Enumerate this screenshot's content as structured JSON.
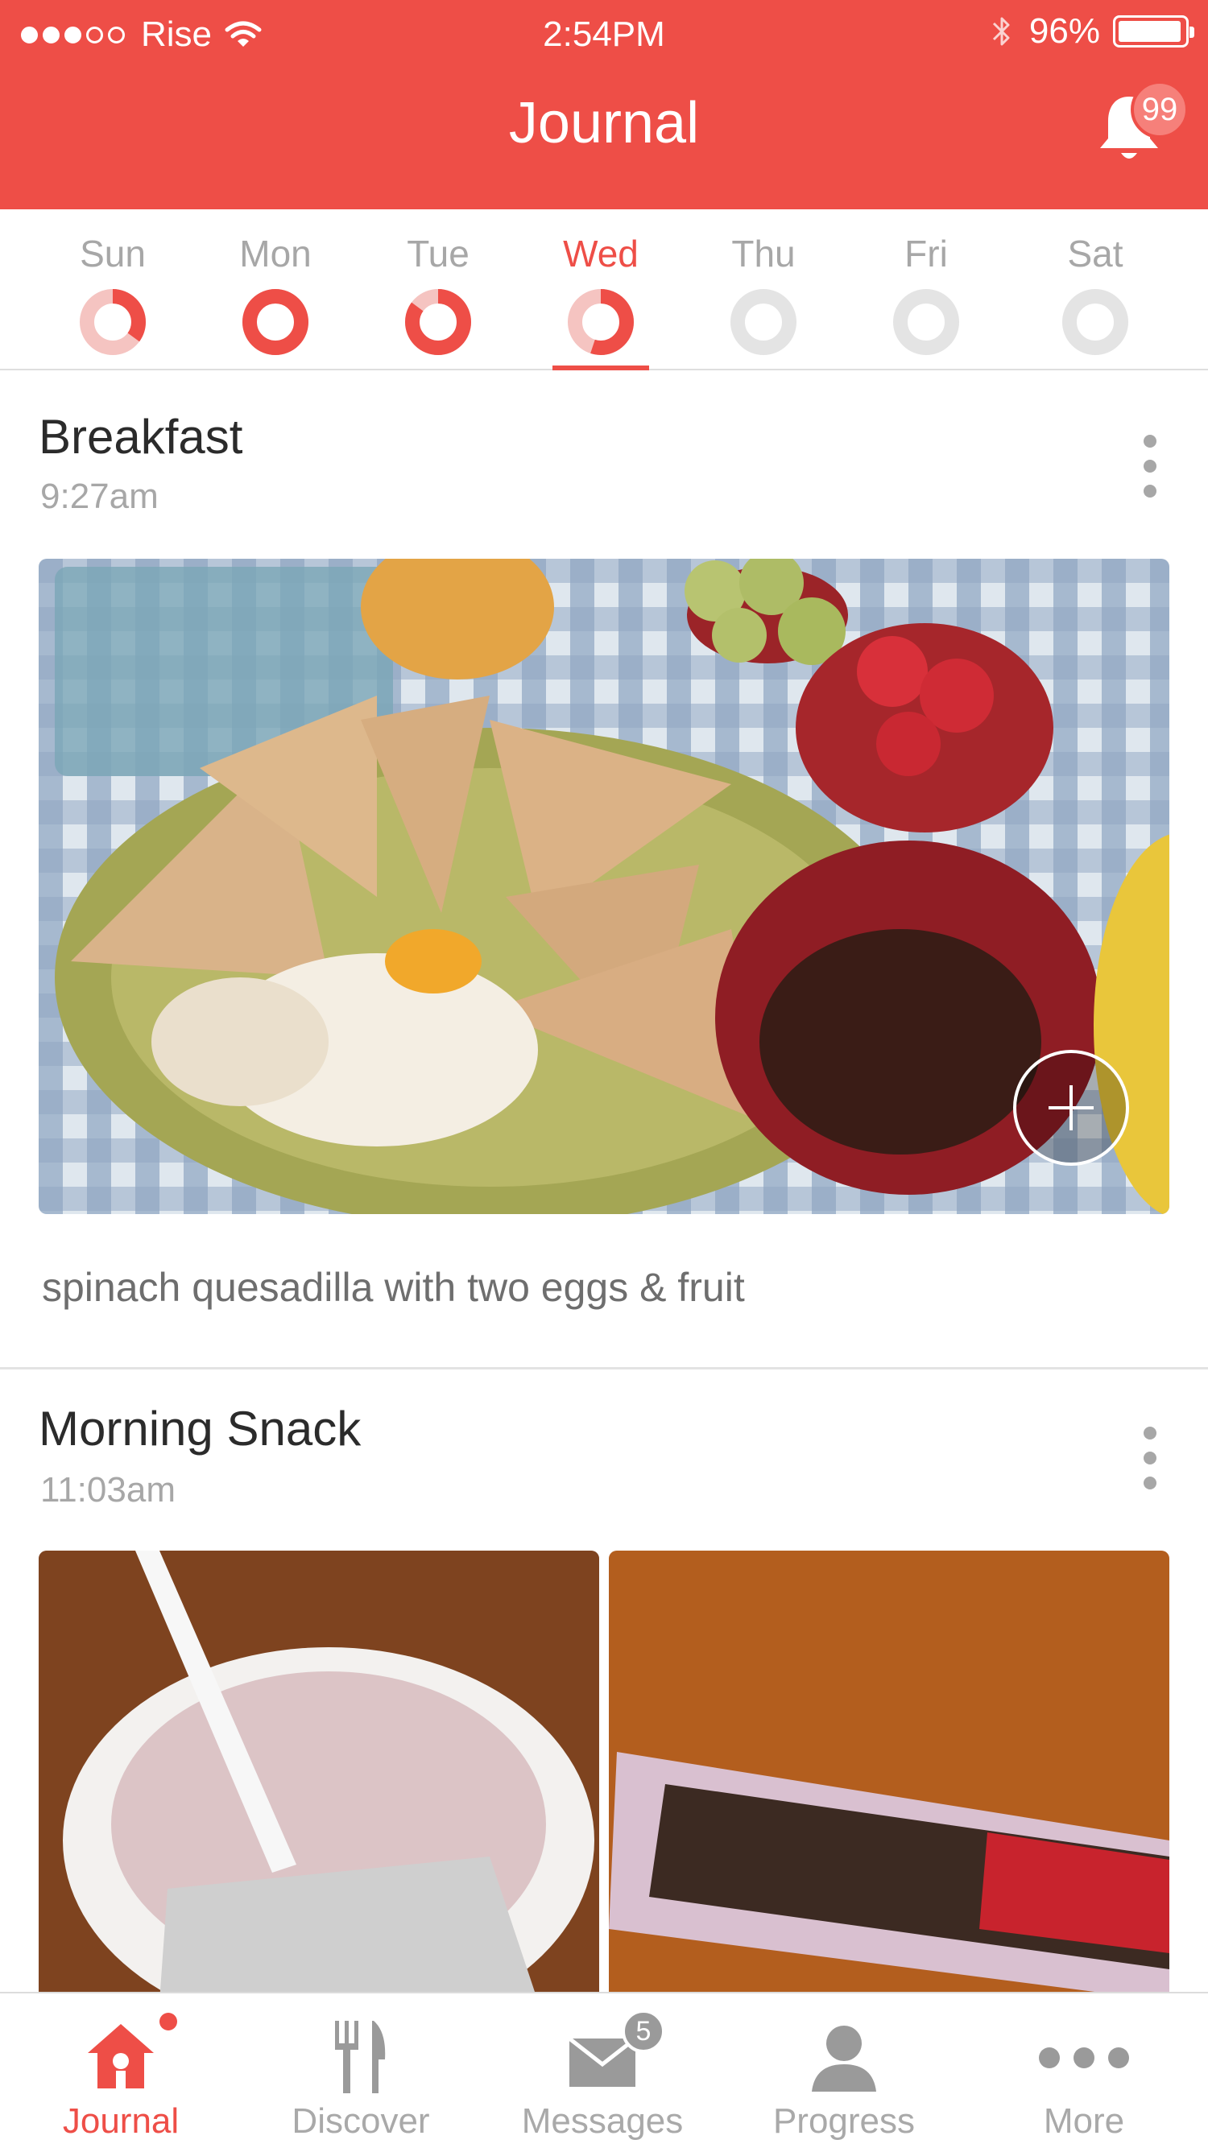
{
  "status_bar": {
    "carrier": "Rise",
    "time": "2:54PM",
    "battery": "96%",
    "battery_level": 0.96
  },
  "header": {
    "title": "Journal",
    "notification_count": "99"
  },
  "days": [
    {
      "label": "Sun",
      "progress": 0.35,
      "active": false
    },
    {
      "label": "Mon",
      "progress": 1.0,
      "active": false
    },
    {
      "label": "Tue",
      "progress": 0.85,
      "active": false
    },
    {
      "label": "Wed",
      "progress": 0.55,
      "active": true
    },
    {
      "label": "Thu",
      "progress": 0,
      "active": false
    },
    {
      "label": "Fri",
      "progress": 0,
      "active": false
    },
    {
      "label": "Sat",
      "progress": 0,
      "active": false
    }
  ],
  "entries": [
    {
      "title": "Breakfast",
      "time": "9:27am",
      "caption": "spinach quesadilla with two eggs & fruit"
    },
    {
      "title": "Morning Snack",
      "time": "11:03am"
    }
  ],
  "tabs": [
    {
      "label": "Journal",
      "icon": "house-icon",
      "active": true
    },
    {
      "label": "Discover",
      "icon": "fork-knife-icon",
      "active": false
    },
    {
      "label": "Messages",
      "icon": "envelope-icon",
      "badge": "5",
      "active": false
    },
    {
      "label": "Progress",
      "icon": "person-icon",
      "active": false
    },
    {
      "label": "More",
      "icon": "more-dots-icon",
      "active": false
    }
  ],
  "colors": {
    "accent": "#ee4e47",
    "ring_light": "#f5c4c1",
    "ring_empty": "#e4e4e4",
    "inactive_text": "#a7a7a7"
  }
}
